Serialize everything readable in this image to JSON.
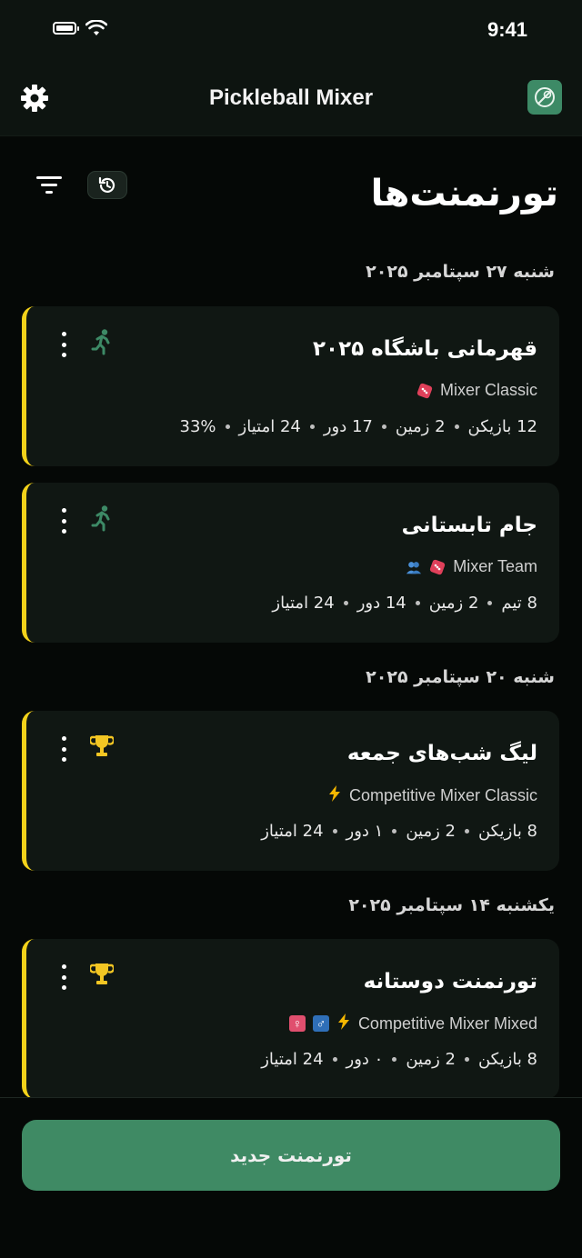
{
  "status_bar": {
    "time": "9:41"
  },
  "app_bar": {
    "title": "Pickleball Mixer"
  },
  "page_title": "تورنمنت‌ها",
  "colors": {
    "accent_green": "#3f8a64",
    "card_stripe": "#f3d21a",
    "bg": "#050806"
  },
  "groups": [
    {
      "date": "شنبه ۲۷ سپتامبر ۲۰۲۵",
      "cards": [
        {
          "title": "قهرمانی باشگاه ۲۰۲۵",
          "mode": "Mixer Classic",
          "status_icon": "running-person-icon",
          "badges": [
            "dice-icon"
          ],
          "meta": [
            "12 بازیکن",
            "2 زمین",
            "17 دور",
            "24 امتیاز",
            "33%"
          ]
        },
        {
          "title": "جام تابستانی",
          "mode": "Mixer Team",
          "status_icon": "running-person-icon",
          "badges": [
            "dice-icon",
            "team-icon"
          ],
          "meta": [
            "8 تیم",
            "2 زمین",
            "14 دور",
            "24 امتیاز"
          ]
        }
      ]
    },
    {
      "date": "شنبه ۲۰ سپتامبر ۲۰۲۵",
      "cards": [
        {
          "title": "لیگ شب‌های جمعه",
          "mode": "Competitive Mixer Classic",
          "status_icon": "trophy-icon",
          "badges": [
            "lightning-icon"
          ],
          "meta": [
            "8 بازیکن",
            "2 زمین",
            "۱ دور",
            "24 امتیاز"
          ]
        }
      ]
    },
    {
      "date": "یکشنبه ۱۴ سپتامبر ۲۰۲۵",
      "cards": [
        {
          "title": "تورنمنت دوستانه",
          "mode": "Competitive Mixer Mixed",
          "status_icon": "trophy-icon",
          "badges": [
            "lightning-icon",
            "male-icon",
            "female-icon"
          ],
          "meta": [
            "8 بازیکن",
            "2 زمین",
            "۰ دور",
            "24 امتیاز"
          ]
        }
      ]
    }
  ],
  "new_button_label": "تورنمنت جدید"
}
